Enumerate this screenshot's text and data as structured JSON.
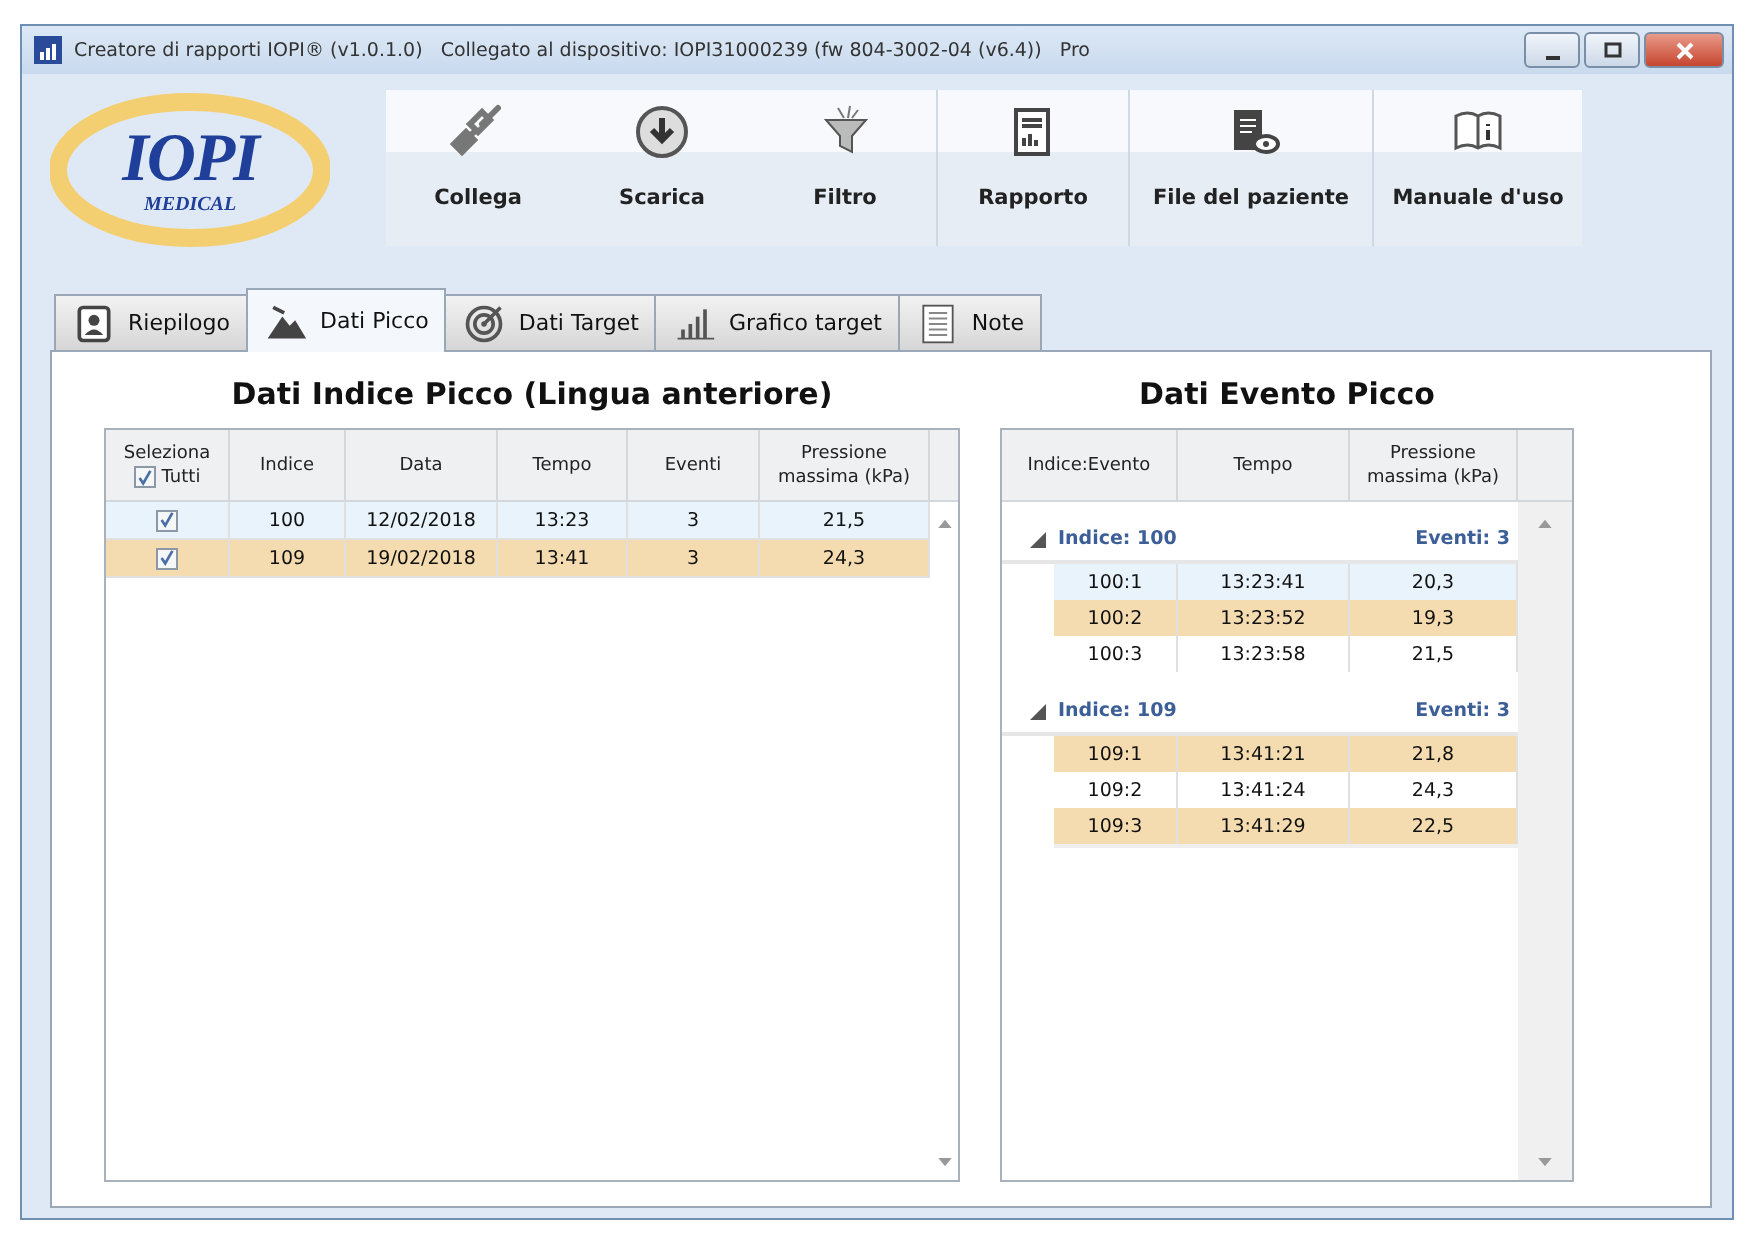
{
  "window": {
    "title": "Creatore di rapporti IOPI® (v1.0.1.0)   Collegato al dispositivo: IOPI31000239 (fw 804-3002-04 (v6.4))   Pro"
  },
  "logo": {
    "name": "IOPI",
    "sub": "MEDICAL"
  },
  "toolbar": [
    {
      "label": "Collega"
    },
    {
      "label": "Scarica"
    },
    {
      "label": "Filtro"
    },
    {
      "label": "Rapporto"
    },
    {
      "label": "File del paziente"
    },
    {
      "label": "Manuale d'uso"
    }
  ],
  "tabs": [
    {
      "label": "Riepilogo",
      "selected": false
    },
    {
      "label": "Dati Picco",
      "selected": true
    },
    {
      "label": "Dati Target",
      "selected": false
    },
    {
      "label": "Grafico target",
      "selected": false
    },
    {
      "label": "Note",
      "selected": false
    }
  ],
  "index_table": {
    "title": "Dati Indice Picco (Lingua anteriore)",
    "select_all": {
      "label_top": "Seleziona",
      "label": "Tutti",
      "checked": true
    },
    "columns": [
      "Indice",
      "Data",
      "Tempo",
      "Eventi",
      "Pressione massima (kPa)"
    ],
    "rows": [
      {
        "checked": true,
        "hovered": true,
        "selected": false,
        "cells": [
          "100",
          "12/02/2018",
          "13:23",
          "3",
          "21,5"
        ]
      },
      {
        "checked": true,
        "hovered": false,
        "selected": true,
        "cells": [
          "109",
          "19/02/2018",
          "13:41",
          "3",
          "24,3"
        ]
      }
    ]
  },
  "event_table": {
    "title": "Dati Evento Picco",
    "columns": [
      "Indice:Evento",
      "Tempo",
      "Pressione massima (kPa)"
    ],
    "groups": [
      {
        "label": "Indice: 100",
        "count": "Eventi: 3",
        "expanded": true,
        "rows": [
          {
            "hovered": true,
            "selected": false,
            "cells": [
              "100:1",
              "13:23:41",
              "20,3"
            ]
          },
          {
            "hovered": false,
            "selected": true,
            "cells": [
              "100:2",
              "13:23:52",
              "19,3"
            ]
          },
          {
            "hovered": false,
            "selected": false,
            "cells": [
              "100:3",
              "13:23:58",
              "21,5"
            ]
          }
        ]
      },
      {
        "label": "Indice: 109",
        "count": "Eventi: 3",
        "expanded": true,
        "rows": [
          {
            "hovered": false,
            "selected": true,
            "cells": [
              "109:1",
              "13:41:21",
              "21,8"
            ]
          },
          {
            "hovered": false,
            "selected": false,
            "cells": [
              "109:2",
              "13:41:24",
              "24,3"
            ]
          },
          {
            "hovered": false,
            "selected": true,
            "cells": [
              "109:3",
              "13:41:29",
              "22,5"
            ]
          }
        ]
      }
    ]
  }
}
